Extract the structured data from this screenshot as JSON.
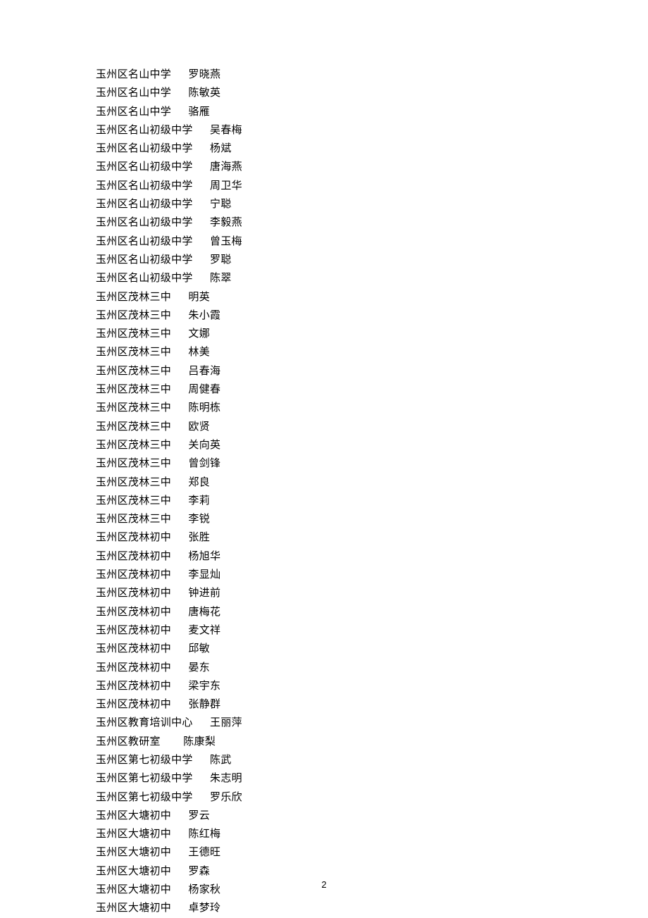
{
  "rows": [
    {
      "school": "玉州区名山中学",
      "gap": "      ",
      "name": "罗晓燕"
    },
    {
      "school": "玉州区名山中学",
      "gap": "      ",
      "name": "陈敏英"
    },
    {
      "school": "玉州区名山中学",
      "gap": "      ",
      "name": "骆雁"
    },
    {
      "school": "玉州区名山初级中学",
      "gap": "      ",
      "name": "吴春梅"
    },
    {
      "school": "玉州区名山初级中学",
      "gap": "      ",
      "name": "杨斌"
    },
    {
      "school": "玉州区名山初级中学",
      "gap": "      ",
      "name": "唐海燕"
    },
    {
      "school": "玉州区名山初级中学",
      "gap": "      ",
      "name": "周卫华"
    },
    {
      "school": "玉州区名山初级中学",
      "gap": "      ",
      "name": "宁聪"
    },
    {
      "school": "玉州区名山初级中学",
      "gap": "      ",
      "name": "李毅燕"
    },
    {
      "school": "玉州区名山初级中学",
      "gap": "      ",
      "name": "曾玉梅"
    },
    {
      "school": "玉州区名山初级中学",
      "gap": "      ",
      "name": "罗聪"
    },
    {
      "school": "玉州区名山初级中学",
      "gap": "      ",
      "name": "陈翠"
    },
    {
      "school": "玉州区茂林三中",
      "gap": "      ",
      "name": "明英"
    },
    {
      "school": "玉州区茂林三中",
      "gap": "      ",
      "name": "朱小霞"
    },
    {
      "school": "玉州区茂林三中",
      "gap": "      ",
      "name": "文娜"
    },
    {
      "school": "玉州区茂林三中",
      "gap": "      ",
      "name": "林美"
    },
    {
      "school": "玉州区茂林三中",
      "gap": "      ",
      "name": "吕春海"
    },
    {
      "school": "玉州区茂林三中",
      "gap": "      ",
      "name": "周健春"
    },
    {
      "school": "玉州区茂林三中",
      "gap": "      ",
      "name": "陈明栋"
    },
    {
      "school": "玉州区茂林三中",
      "gap": "      ",
      "name": "欧贤"
    },
    {
      "school": "玉州区茂林三中",
      "gap": "      ",
      "name": "关向英"
    },
    {
      "school": "玉州区茂林三中",
      "gap": "      ",
      "name": "曾剑锋"
    },
    {
      "school": "玉州区茂林三中",
      "gap": "      ",
      "name": "郑良"
    },
    {
      "school": "玉州区茂林三中",
      "gap": "      ",
      "name": "李莉"
    },
    {
      "school": "玉州区茂林三中",
      "gap": "      ",
      "name": "李锐"
    },
    {
      "school": "玉州区茂林初中",
      "gap": "      ",
      "name": "张胜"
    },
    {
      "school": "玉州区茂林初中",
      "gap": "      ",
      "name": "杨旭华"
    },
    {
      "school": "玉州区茂林初中",
      "gap": "      ",
      "name": "李显灿"
    },
    {
      "school": "玉州区茂林初中",
      "gap": "      ",
      "name": "钟进前"
    },
    {
      "school": "玉州区茂林初中",
      "gap": "      ",
      "name": "唐梅花"
    },
    {
      "school": "玉州区茂林初中",
      "gap": "      ",
      "name": "麦文祥"
    },
    {
      "school": "玉州区茂林初中",
      "gap": "      ",
      "name": "邱敏"
    },
    {
      "school": "玉州区茂林初中",
      "gap": "      ",
      "name": "晏东"
    },
    {
      "school": "玉州区茂林初中",
      "gap": "      ",
      "name": "梁宇东"
    },
    {
      "school": "玉州区茂林初中",
      "gap": "      ",
      "name": "张静群"
    },
    {
      "school": "玉州区教育培训中心",
      "gap": "      ",
      "name": "王丽萍"
    },
    {
      "school": "玉州区教研室",
      "gap": "        ",
      "name": "陈康梨"
    },
    {
      "school": "玉州区第七初级中学",
      "gap": "      ",
      "name": "陈武"
    },
    {
      "school": "玉州区第七初级中学",
      "gap": "      ",
      "name": "朱志明"
    },
    {
      "school": "玉州区第七初级中学",
      "gap": "      ",
      "name": "罗乐欣"
    },
    {
      "school": "玉州区大塘初中",
      "gap": "      ",
      "name": "罗云"
    },
    {
      "school": "玉州区大塘初中",
      "gap": "      ",
      "name": "陈红梅"
    },
    {
      "school": "玉州区大塘初中",
      "gap": "      ",
      "name": "王德旺"
    },
    {
      "school": "玉州区大塘初中",
      "gap": "      ",
      "name": "罗森"
    },
    {
      "school": "玉州区大塘初中",
      "gap": "      ",
      "name": "杨家秋"
    },
    {
      "school": "玉州区大塘初中",
      "gap": "      ",
      "name": "卓梦玲"
    }
  ],
  "pageNumber": "2"
}
